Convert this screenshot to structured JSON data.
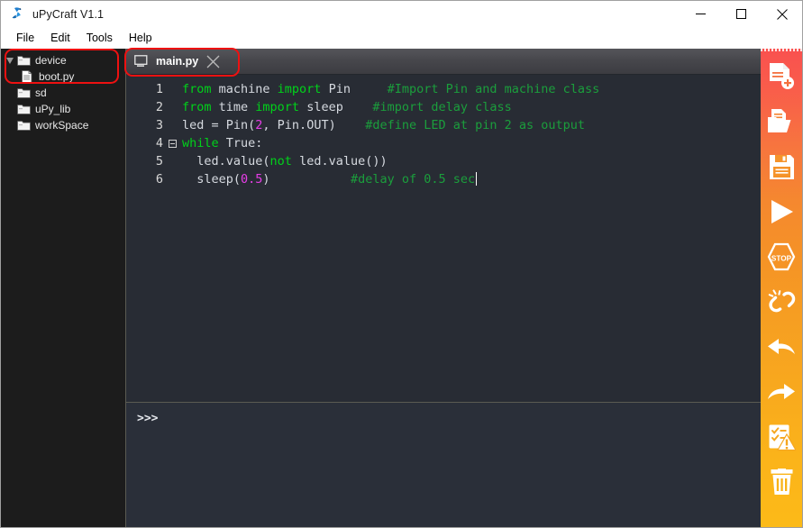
{
  "window": {
    "title": "uPyCraft V1.1",
    "app_icon": "upycraft-logo-icon",
    "controls": {
      "minimize": "minimize-icon",
      "maximize": "maximize-icon",
      "close": "close-icon"
    }
  },
  "menubar": {
    "items": [
      {
        "label": "File"
      },
      {
        "label": "Edit"
      },
      {
        "label": "Tools"
      },
      {
        "label": "Help"
      }
    ]
  },
  "sidebar": {
    "items": [
      {
        "label": "device",
        "icon": "folder-icon",
        "expanded": true,
        "indent": 0,
        "has_twisty": true
      },
      {
        "label": "boot.py",
        "icon": "file-icon",
        "expanded": false,
        "indent": 1,
        "has_twisty": false
      },
      {
        "label": "sd",
        "icon": "folder-icon",
        "expanded": false,
        "indent": 0,
        "has_twisty": false
      },
      {
        "label": "uPy_lib",
        "icon": "folder-icon",
        "expanded": false,
        "indent": 0,
        "has_twisty": false
      },
      {
        "label": "workSpace",
        "icon": "folder-icon",
        "expanded": false,
        "indent": 0,
        "has_twisty": false
      }
    ]
  },
  "tabs": [
    {
      "label": "main.py",
      "icon": "screen-icon",
      "close_icon": "close-icon",
      "active": true
    }
  ],
  "editor": {
    "line_numbers": [
      "1",
      "2",
      "3",
      "4",
      "5",
      "6"
    ],
    "fold_marker_line": 4,
    "lines": [
      [
        {
          "t": "kw",
          "s": "from"
        },
        {
          "t": "txt",
          "s": " machine "
        },
        {
          "t": "kw",
          "s": "import"
        },
        {
          "t": "txt",
          "s": " Pin     "
        },
        {
          "t": "com",
          "s": "#Import Pin and machine class"
        }
      ],
      [
        {
          "t": "kw",
          "s": "from"
        },
        {
          "t": "txt",
          "s": " time "
        },
        {
          "t": "kw",
          "s": "import"
        },
        {
          "t": "txt",
          "s": " sleep    "
        },
        {
          "t": "com",
          "s": "#import delay class"
        }
      ],
      [
        {
          "t": "txt",
          "s": "led = Pin("
        },
        {
          "t": "num",
          "s": "2"
        },
        {
          "t": "txt",
          "s": ", Pin.OUT)    "
        },
        {
          "t": "com",
          "s": "#define LED at pin 2 as output"
        }
      ],
      [
        {
          "t": "kw",
          "s": "while"
        },
        {
          "t": "txt",
          "s": " True:"
        }
      ],
      [
        {
          "t": "txt",
          "s": "  led.value("
        },
        {
          "t": "kw",
          "s": "not"
        },
        {
          "t": "txt",
          "s": " led.value())"
        }
      ],
      [
        {
          "t": "txt",
          "s": "  sleep("
        },
        {
          "t": "num",
          "s": "0.5"
        },
        {
          "t": "txt",
          "s": ")           "
        },
        {
          "t": "com",
          "s": "#delay of 0.5 sec"
        },
        {
          "t": "caret",
          "s": ""
        }
      ]
    ]
  },
  "terminal": {
    "prompt": ">>>"
  },
  "toolbar": {
    "buttons": [
      {
        "name": "new-file-button",
        "icon": "new-file-icon"
      },
      {
        "name": "open-file-button",
        "icon": "open-folder-icon"
      },
      {
        "name": "save-file-button",
        "icon": "save-floppy-icon"
      },
      {
        "name": "run-button",
        "icon": "play-icon"
      },
      {
        "name": "stop-button",
        "icon": "stop-icon"
      },
      {
        "name": "disconnect-button",
        "icon": "broken-link-icon"
      },
      {
        "name": "undo-button",
        "icon": "undo-arrow-icon"
      },
      {
        "name": "redo-button",
        "icon": "redo-arrow-icon"
      },
      {
        "name": "syntax-check-button",
        "icon": "checklist-warning-icon"
      },
      {
        "name": "delete-button",
        "icon": "trash-icon"
      }
    ]
  },
  "annotations": {
    "highlight_color": "#ee1111",
    "boxes": [
      {
        "name": "device-tree-highlight"
      },
      {
        "name": "main-tab-highlight"
      }
    ]
  },
  "colors": {
    "toolbar_top": "#f9514f",
    "toolbar_bottom": "#fcba18",
    "editor_bg": "#282c34",
    "sidebar_bg": "#1c1c1c",
    "terminal_bg": "#2a2f39",
    "keyword": "#00d21a",
    "comment": "#1b9e3c",
    "number": "#e83ee8",
    "text": "#d6dae0"
  }
}
